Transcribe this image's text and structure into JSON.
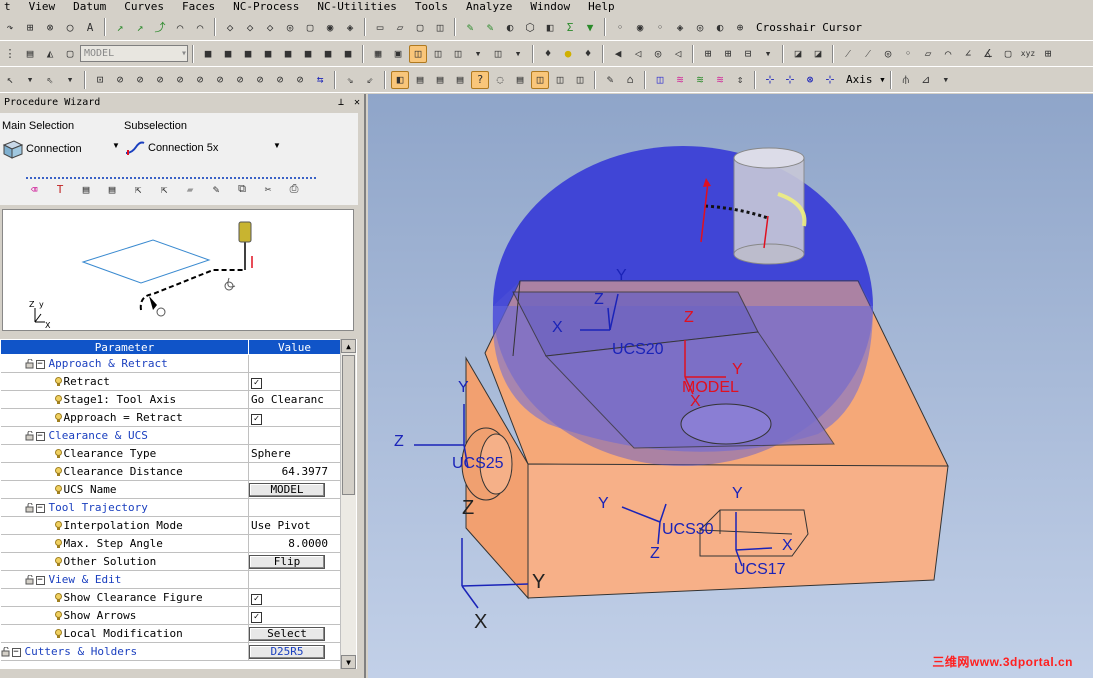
{
  "menu": [
    "t",
    "View",
    "Datum",
    "Curves",
    "Faces",
    "NC-Process",
    "NC-Utilities",
    "Tools",
    "Analyze",
    "Window",
    "Help"
  ],
  "toolbar": {
    "model_combo": "MODEL",
    "crosshair_label": "Crosshair Cursor",
    "axis_label": "Axis"
  },
  "wizard": {
    "title": "Procedure Wizard",
    "main_selection_label": "Main Selection",
    "subselection_label": "Subselection",
    "main_value": "Connection",
    "sub_value": "Connection 5x"
  },
  "preview": {
    "axis_z": "Z",
    "axis_y": "y",
    "axis_x": "X"
  },
  "grid": {
    "headers": [
      "Parameter",
      "Value"
    ],
    "rows": [
      {
        "type": "group",
        "label": "Approach & Retract"
      },
      {
        "type": "item",
        "label": "Retract",
        "value": "",
        "checked": true
      },
      {
        "type": "item",
        "label": "Stage1: Tool Axis",
        "value": "Go Clearanc"
      },
      {
        "type": "item",
        "label": "Approach = Retract",
        "value": "",
        "checked": true
      },
      {
        "type": "group",
        "label": "Clearance & UCS"
      },
      {
        "type": "item",
        "label": "Clearance Type",
        "value": "Sphere"
      },
      {
        "type": "item",
        "label": "Clearance Distance",
        "value": "64.3977",
        "num": true
      },
      {
        "type": "item",
        "label": "UCS Name",
        "value": "MODEL",
        "button": true
      },
      {
        "type": "group",
        "label": "Tool Trajectory"
      },
      {
        "type": "item",
        "label": "Interpolation Mode",
        "value": "Use Pivot"
      },
      {
        "type": "item",
        "label": "Max. Step Angle",
        "value": "8.0000",
        "num": true
      },
      {
        "type": "item",
        "label": "Other Solution",
        "value": "Flip",
        "button": true
      },
      {
        "type": "group",
        "label": "View & Edit"
      },
      {
        "type": "item",
        "label": "Show Clearance Figure",
        "value": "",
        "checked": true
      },
      {
        "type": "item",
        "label": "Show Arrows",
        "value": "",
        "checked": true
      },
      {
        "type": "item",
        "label": "Local Modification",
        "value": "Select",
        "button": true
      },
      {
        "type": "group",
        "label": "Cutters & Holders",
        "value": "D25R5",
        "button": true,
        "top": true
      }
    ]
  },
  "viewport": {
    "labels": {
      "ucs20": "UCS20",
      "ucs25": "UCS25",
      "ucs30": "UCS30",
      "ucs17": "UCS17",
      "model": "MODEL",
      "y": "Y",
      "z": "Z",
      "x": "X"
    }
  },
  "watermark": "三维网www.3dportal.cn",
  "colors": {
    "sphere": "#3b3fd6",
    "body": "#f5a878",
    "header": "#1054c8",
    "axis_blue": "#1a23b8",
    "axis_red": "#e01020"
  }
}
